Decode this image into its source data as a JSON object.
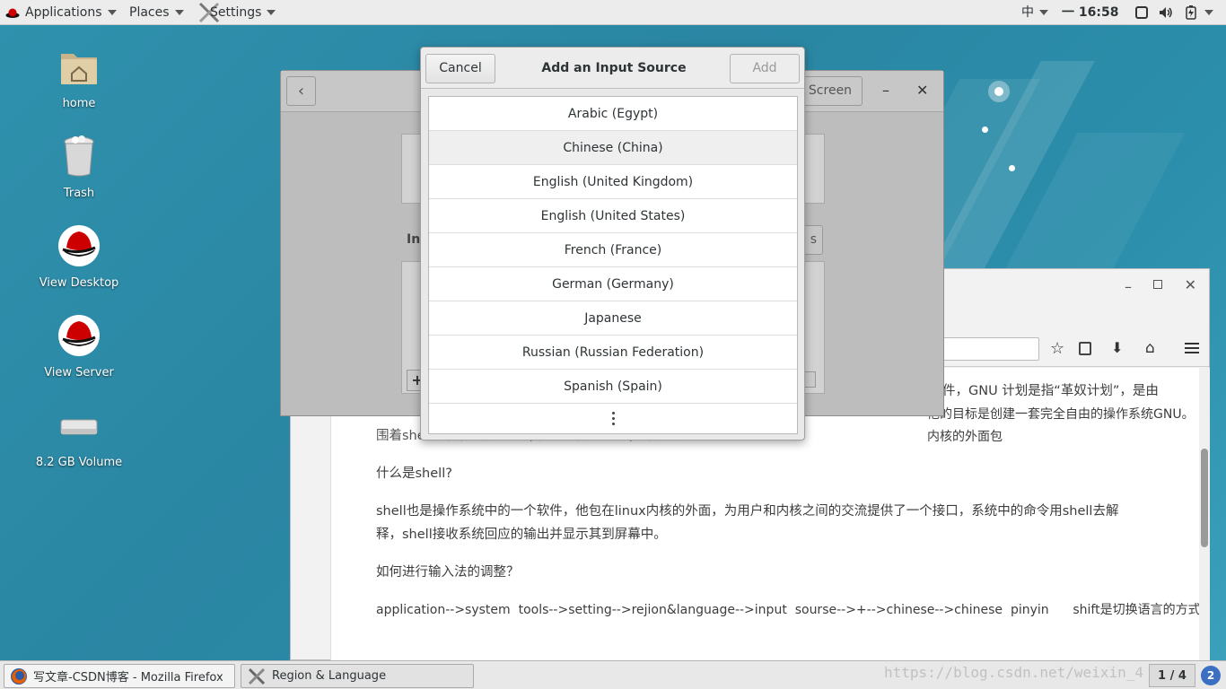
{
  "topbar": {
    "applications": "Applications",
    "places": "Places",
    "settings": "Settings",
    "input_method": "中",
    "clock": "一 16:58"
  },
  "desktop_icons": [
    {
      "label": "home",
      "icon": "home-folder-icon"
    },
    {
      "label": "Trash",
      "icon": "trash-icon"
    },
    {
      "label": "View Desktop",
      "icon": "redhat-icon"
    },
    {
      "label": "View Server",
      "icon": "redhat-icon"
    },
    {
      "label": "8.2 GB Volume",
      "icon": "drive-icon"
    }
  ],
  "settings_window": {
    "screen_label": "Screen",
    "input_label_fragment": "Inp",
    "fragment_s": "s"
  },
  "dialog": {
    "title": "Add an Input Source",
    "cancel": "Cancel",
    "add": "Add",
    "items": [
      "Arabic (Egypt)",
      "Chinese (China)",
      "English (United Kingdom)",
      "English (United States)",
      "French (France)",
      "German (Germany)",
      "Japanese",
      "Russian (Russian Federation)",
      "Spanish (Spain)"
    ],
    "selected_index": 1
  },
  "browser": {
    "text1": "的软件，GNU 计划是指“革奴计划”，是由",
    "text2": "他的目标是创建一套完全自由的操作系统GNU。内核的外面包",
    "text3": "围着shell进行程序和shell(常用版本是bash)进行交流。",
    "question1": "什么是shell?",
    "answer1a": "shell也是操作系统中的一个软件，他包在linux内核的外面，为用户和内核之间的交流提供了一个接口，系统中的命令用shell去解",
    "answer1b": "释，shell接收系统回应的输出并显示其到屏幕中。",
    "question2": "如何进行输入法的调整？",
    "answer2": "application-->system  tools-->setting-->rejion&language-->input  sourse-->+-->chinese-->chinese  pinyin      shift是切换语言的方式"
  },
  "taskbar": {
    "task1": "写文章-CSDN博客 - Mozilla Firefox",
    "task2": "Region & Language",
    "pager": "1 / 4",
    "watermark": "https://blog.csdn.net/weixin_4"
  },
  "colors": {
    "desktop": "#2e8aa8",
    "panel": "#ececec"
  }
}
